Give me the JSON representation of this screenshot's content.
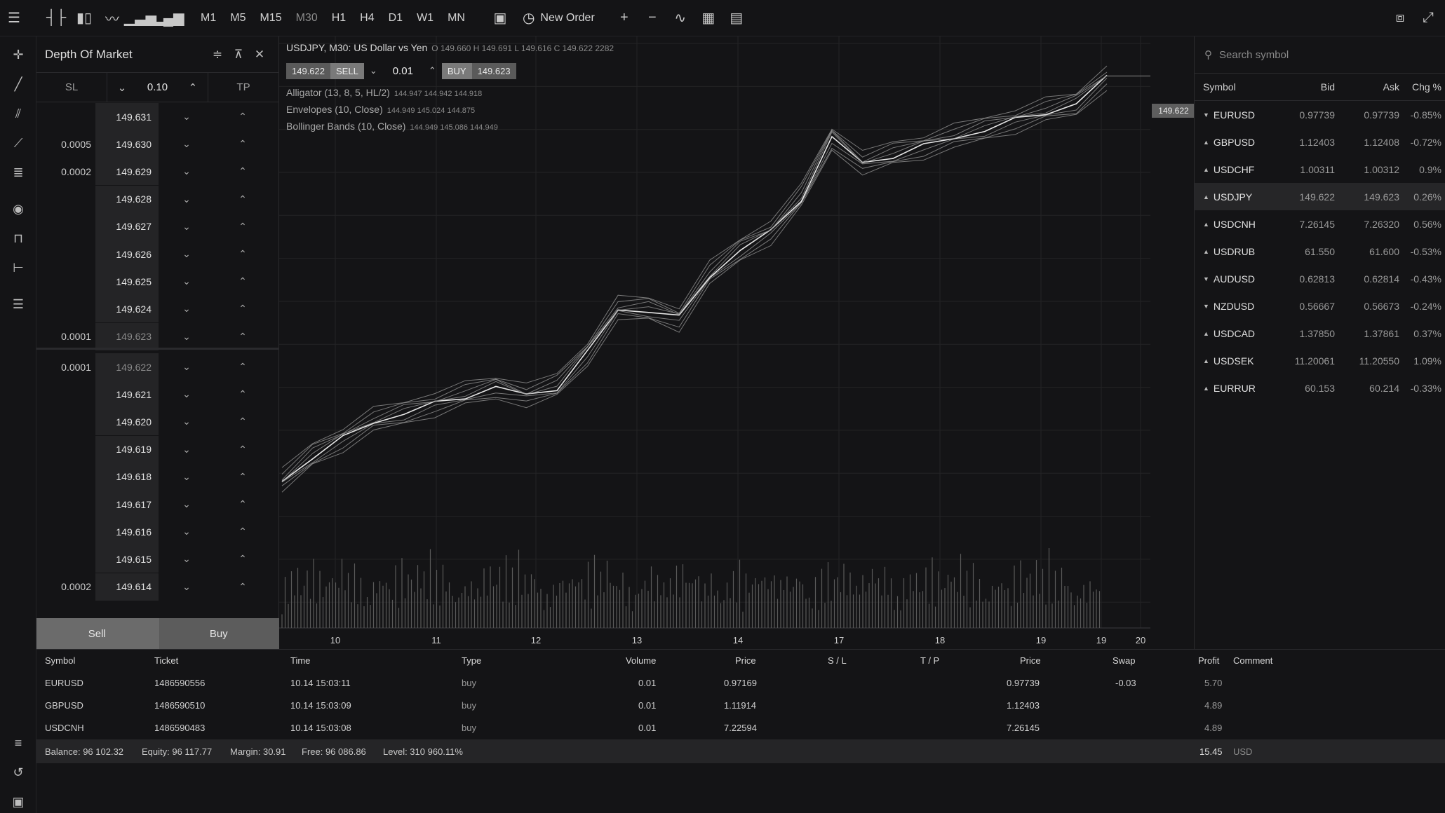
{
  "toolbar": {
    "timeframes": [
      "M1",
      "M5",
      "M15",
      "M30",
      "H1",
      "H4",
      "D1",
      "W1",
      "MN"
    ],
    "active_timeframe": "M30",
    "new_order": "New Order"
  },
  "dom": {
    "title": "Depth Of Market",
    "sl": "SL",
    "tp": "TP",
    "volume": "0.10",
    "asks": [
      {
        "vol": "",
        "price": "149.631"
      },
      {
        "vol": "0.0005",
        "price": "149.630"
      },
      {
        "vol": "0.0002",
        "price": "149.629"
      },
      {
        "vol": "",
        "price": "149.628"
      },
      {
        "vol": "",
        "price": "149.627"
      },
      {
        "vol": "",
        "price": "149.626"
      },
      {
        "vol": "",
        "price": "149.625"
      },
      {
        "vol": "",
        "price": "149.624"
      },
      {
        "vol": "0.0001",
        "price": "149.623"
      }
    ],
    "bids": [
      {
        "vol": "0.0001",
        "price": "149.622"
      },
      {
        "vol": "",
        "price": "149.621"
      },
      {
        "vol": "",
        "price": "149.620"
      },
      {
        "vol": "",
        "price": "149.619"
      },
      {
        "vol": "",
        "price": "149.618"
      },
      {
        "vol": "",
        "price": "149.617"
      },
      {
        "vol": "",
        "price": "149.616"
      },
      {
        "vol": "",
        "price": "149.615"
      },
      {
        "vol": "0.0002",
        "price": "149.614"
      }
    ],
    "sell": "Sell",
    "buy": "Buy"
  },
  "chart": {
    "symbol_title": "USDJPY, M30: US Dollar vs Yen",
    "ohlc": "O 149.660 H 149.691 L 149.616 C 149.622 2282",
    "sell_price": "149.622",
    "sell_label": "SELL",
    "lot": "0.01",
    "buy_label": "BUY",
    "buy_price": "149.623",
    "indicators": [
      {
        "name": "Alligator (13, 8, 5, HL/2)",
        "values": "144.947 144.942 144.918"
      },
      {
        "name": "Envelopes (10, Close)",
        "values": "144.949 145.024 144.875"
      },
      {
        "name": "Bollinger Bands (10, Close)",
        "values": "144.949 145.086 144.949"
      }
    ],
    "current_price_tag": "149.622"
  },
  "chart_data": {
    "type": "line",
    "x": [
      "10",
      "11",
      "12",
      "13",
      "14",
      "17",
      "18",
      "19",
      "19",
      "20"
    ],
    "y_ticks": [
      "150.000",
      "149.500",
      "149.000",
      "148.500",
      "148.000",
      "147.500",
      "147.000",
      "146.500",
      "146.000",
      "145.500",
      "145.000",
      "144.500",
      "144.000",
      "143.500"
    ],
    "ylim": [
      143.2,
      150.0
    ],
    "series": [
      {
        "values": [
          144.9,
          145.2,
          145.4,
          145.6,
          145.7,
          145.8,
          145.9,
          146.0,
          145.9,
          146.0,
          146.4,
          146.9,
          146.9,
          146.8,
          147.3,
          147.6,
          147.8,
          148.2,
          148.9,
          148.6,
          148.7,
          148.8,
          148.9,
          149.0,
          149.1,
          149.2,
          149.3,
          149.6
        ]
      }
    ],
    "volume": [
      30,
      45,
      38,
      52,
      41,
      60,
      35,
      48,
      55,
      40,
      62,
      44,
      50,
      58,
      37,
      65,
      47,
      53,
      42,
      70,
      46,
      51,
      39,
      57,
      49,
      44,
      36,
      28
    ]
  },
  "watchlist": {
    "search_placeholder": "Search symbol",
    "headers": {
      "symbol": "Symbol",
      "bid": "Bid",
      "ask": "Ask",
      "chg": "Chg %"
    },
    "rows": [
      {
        "symbol": "EURUSD",
        "dir": "down",
        "bid": "0.97739",
        "ask": "0.97739",
        "chg": "-0.85%"
      },
      {
        "symbol": "GBPUSD",
        "dir": "up",
        "bid": "1.12403",
        "ask": "1.12408",
        "chg": "-0.72%"
      },
      {
        "symbol": "USDCHF",
        "dir": "up",
        "bid": "1.00311",
        "ask": "1.00312",
        "chg": "0.9%"
      },
      {
        "symbol": "USDJPY",
        "dir": "up",
        "bid": "149.622",
        "ask": "149.623",
        "chg": "0.26%"
      },
      {
        "symbol": "USDCNH",
        "dir": "up",
        "bid": "7.26145",
        "ask": "7.26320",
        "chg": "0.56%"
      },
      {
        "symbol": "USDRUB",
        "dir": "up",
        "bid": "61.550",
        "ask": "61.600",
        "chg": "-0.53%"
      },
      {
        "symbol": "AUDUSD",
        "dir": "down",
        "bid": "0.62813",
        "ask": "0.62814",
        "chg": "-0.43%"
      },
      {
        "symbol": "NZDUSD",
        "dir": "down",
        "bid": "0.56667",
        "ask": "0.56673",
        "chg": "-0.24%"
      },
      {
        "symbol": "USDCAD",
        "dir": "up",
        "bid": "1.37850",
        "ask": "1.37861",
        "chg": "0.37%"
      },
      {
        "symbol": "USDSEK",
        "dir": "up",
        "bid": "11.20061",
        "ask": "11.20550",
        "chg": "1.09%"
      },
      {
        "symbol": "EURRUR",
        "dir": "up",
        "bid": "60.153",
        "ask": "60.214",
        "chg": "-0.33%"
      }
    ]
  },
  "positions": {
    "headers": {
      "symbol": "Symbol",
      "ticket": "Ticket",
      "time": "Time",
      "type": "Type",
      "volume": "Volume",
      "price": "Price",
      "sl": "S / L",
      "tp": "T / P",
      "price2": "Price",
      "swap": "Swap",
      "profit": "Profit",
      "comment": "Comment"
    },
    "rows": [
      {
        "symbol": "EURUSD",
        "ticket": "1486590556",
        "time": "10.14 15:03:11",
        "type": "buy",
        "volume": "0.01",
        "price": "0.97169",
        "price2": "0.97739",
        "swap": "-0.03",
        "profit": "5.70"
      },
      {
        "symbol": "GBPUSD",
        "ticket": "1486590510",
        "time": "10.14 15:03:09",
        "type": "buy",
        "volume": "0.01",
        "price": "1.11914",
        "price2": "1.12403",
        "swap": "",
        "profit": "4.89"
      },
      {
        "symbol": "USDCNH",
        "ticket": "1486590483",
        "time": "10.14 15:03:08",
        "type": "buy",
        "volume": "0.01",
        "price": "7.22594",
        "price2": "7.26145",
        "swap": "",
        "profit": "4.89"
      }
    ],
    "balance": "Balance: 96 102.32",
    "equity": "Equity: 96 117.77",
    "margin": "Margin: 30.91",
    "free": "Free: 96 086.86",
    "level": "Level: 310 960.11%",
    "total_profit": "15.45",
    "currency": "USD"
  }
}
